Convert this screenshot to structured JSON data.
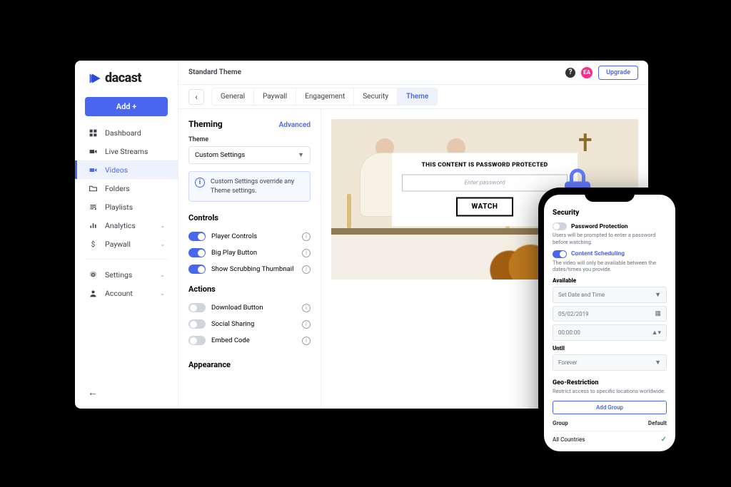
{
  "brand": {
    "name": "dacast"
  },
  "sidebar": {
    "add_label": "Add +",
    "items": [
      {
        "label": "Dashboard"
      },
      {
        "label": "Live Streams"
      },
      {
        "label": "Videos"
      },
      {
        "label": "Folders"
      },
      {
        "label": "Playlists"
      },
      {
        "label": "Analytics"
      },
      {
        "label": "Paywall"
      }
    ],
    "items2": [
      {
        "label": "Settings"
      },
      {
        "label": "Account"
      }
    ]
  },
  "topbar": {
    "breadcrumb": "Standard Theme",
    "avatar_initials": "EA",
    "upgrade_label": "Upgrade"
  },
  "tabs": {
    "items": [
      "General",
      "Paywall",
      "Engagement",
      "Security",
      "Theme"
    ],
    "active": "Theme"
  },
  "theming": {
    "title": "Theming",
    "advanced_label": "Advanced",
    "theme_field_label": "Theme",
    "theme_value": "Custom Settings",
    "hint": "Custom Settings override any Theme settings."
  },
  "controls": {
    "title": "Controls",
    "items": [
      {
        "label": "Player Controls",
        "on": true
      },
      {
        "label": "Big Play Button",
        "on": true
      },
      {
        "label": "Show Scrubbing Thumbnail",
        "on": true
      }
    ]
  },
  "actions": {
    "title": "Actions",
    "items": [
      {
        "label": "Download Button",
        "on": false
      },
      {
        "label": "Social Sharing",
        "on": false
      },
      {
        "label": "Embed Code",
        "on": false
      }
    ]
  },
  "appearance": {
    "title": "Appearance"
  },
  "preview": {
    "protected_title": "THIS CONTENT IS PASSWORD PROTECTED",
    "placeholder": "Enter password",
    "watch_label": "WATCH"
  },
  "phone": {
    "title": "Security",
    "pwd": {
      "label": "Password Protection",
      "desc": "Users will be prompted to enter a password before watching."
    },
    "sched": {
      "label": "Content Scheduling",
      "desc": "The video will only be available between the dates/times you provide."
    },
    "available_label": "Available",
    "available_value": "Set Date and Time",
    "date_value": "05/02/2019",
    "time_value": "00:00:00",
    "until_label": "Until",
    "until_value": "Forever",
    "geo_title": "Geo-Restriction",
    "geo_desc": "Restrict access to specific locations worldwide.",
    "add_group": "Add Group",
    "col_group": "Group",
    "col_default": "Default",
    "row_group": "All Countries"
  }
}
